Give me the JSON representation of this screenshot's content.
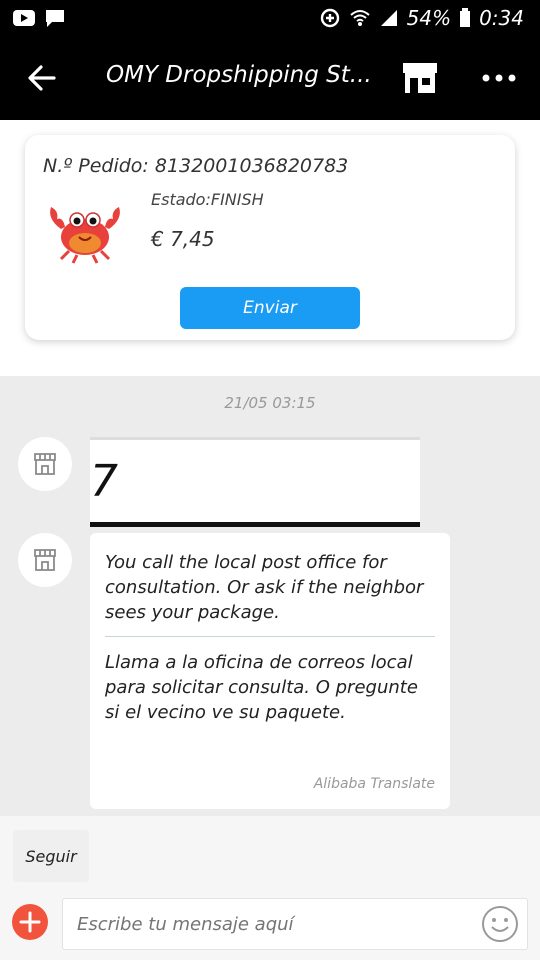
{
  "status_bar": {
    "battery": "54%",
    "time": "0:34"
  },
  "header": {
    "title": "OMY Dropshipping St..."
  },
  "order": {
    "number": "N.º Pedido: 8132001036820783",
    "status": "Estado:FINISH",
    "price": "€ 7,45",
    "send_label": "Enviar"
  },
  "chat": {
    "timestamp": "21/05 03:15",
    "image_message_text": "7",
    "message_en": "You call the local post office for consultation. Or ask if the neighbor sees your package.",
    "message_es": "Llama a la oficina de correos local para solicitar consulta. O pregunte si el vecino ve su paquete.",
    "translate_credit": "Alibaba Translate"
  },
  "footer": {
    "follow_label": "Seguir",
    "input_placeholder": "Escribe tu mensaje aquí"
  },
  "colors": {
    "send_button": "#1a9cf5",
    "plus_button": "#f2533c"
  },
  "icons": {
    "back": "arrow-left-icon",
    "store": "store-icon",
    "more": "more-icon",
    "avatar": "shop-avatar-icon",
    "emoji": "smiley-icon",
    "plus": "plus-icon"
  }
}
